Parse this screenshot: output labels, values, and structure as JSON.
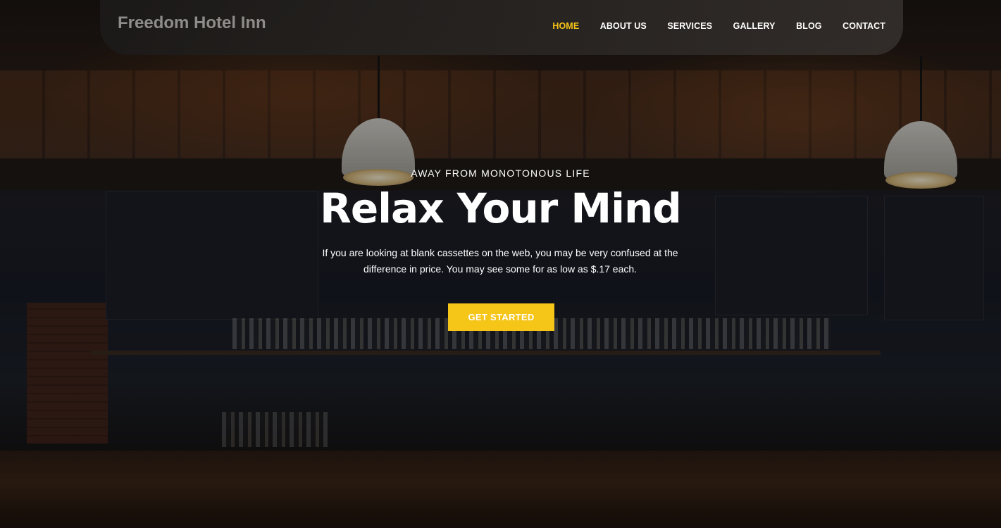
{
  "header": {
    "brand": "Freedom Hotel Inn",
    "nav": [
      {
        "label": "HOME",
        "active": true
      },
      {
        "label": "ABOUT US"
      },
      {
        "label": "SERVICES"
      },
      {
        "label": "GALLERY"
      },
      {
        "label": "BLOG"
      },
      {
        "label": "CONTACT"
      }
    ]
  },
  "hero": {
    "kicker": "AWAY FROM MONOTONOUS LIFE",
    "title": "Relax Your Mind",
    "description_line1": "If you are looking at blank cassettes on the web, you may be very confused at the",
    "description_line2": "difference in price. You may see some for as low as $.17 each.",
    "cta_label": "GET STARTED",
    "background_image": "bar-interior-photo"
  },
  "colors": {
    "accent": "#f5c518",
    "nav_text": "#ffffff",
    "brand_text": "#8e8c88"
  }
}
